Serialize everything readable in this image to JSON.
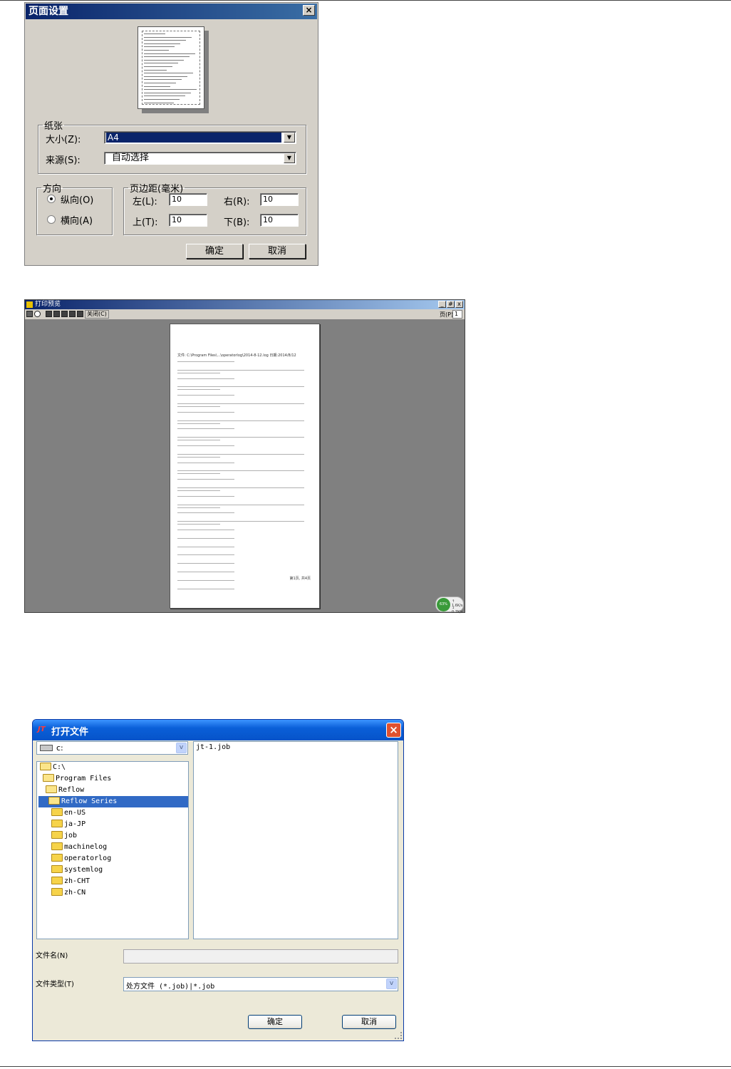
{
  "page_setup": {
    "title": "页面设置",
    "close": "×",
    "paper_group": "纸张",
    "size_label": "大小(Z):",
    "size_value": "A4",
    "source_label": "来源(S):",
    "source_value": "自动选择",
    "orientation_group": "方向",
    "portrait": "纵向(O)",
    "landscape": "横向(A)",
    "margins_group": "页边距(毫米)",
    "left_label": "左(L):",
    "left_value": "10",
    "right_label": "右(R):",
    "right_value": "10",
    "top_label": "上(T):",
    "top_value": "10",
    "bottom_label": "下(B):",
    "bottom_value": "10",
    "ok": "确定",
    "cancel": "取消"
  },
  "print_preview": {
    "title": "打印预览",
    "close_btn": "关闭(C)",
    "page_label": "页(P)",
    "page_value": "1",
    "win_min": "_",
    "win_max": "#",
    "win_close": "x",
    "header_text": "文件: C:\\Program Files\\...\\operatorlog\\2014-8-12.log        日期:2014/8/12",
    "footer_text": "第1页, 共4页",
    "net_pct": "63%",
    "net_up": "↑ 1.6K/s",
    "net_down": "↓ 0.7K/s"
  },
  "open_file": {
    "logo": "JT",
    "title": "打开文件",
    "close": "×",
    "drive_value": "c:",
    "combo_arrow": "v",
    "tree": [
      "C:\\",
      "Program Files",
      "Reflow",
      "Reflow Series",
      "en-US",
      "ja-JP",
      "job",
      "machinelog",
      "operatorlog",
      "systemlog",
      "zh-CHT",
      "zh-CN"
    ],
    "files": [
      "jt-1.job"
    ],
    "filename_label": "文件名(N)",
    "filetype_label": "文件类型(T)",
    "filetype_value": "处方文件 (*.job)|*.job",
    "ok": "确定",
    "cancel": "取消"
  }
}
